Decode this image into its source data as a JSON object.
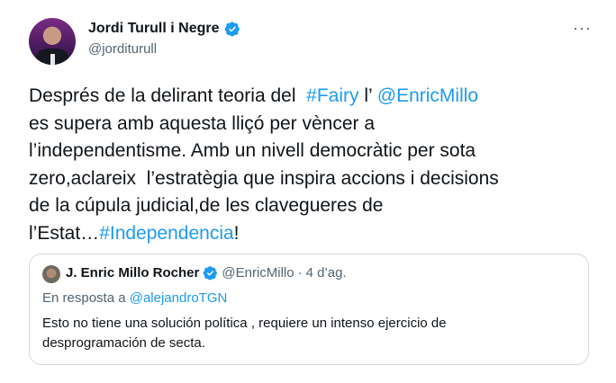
{
  "tweet": {
    "author_name": "Jordi Turull i Negre",
    "author_handle": "@jorditurull",
    "more_label": "···",
    "body": {
      "l1a": "Després de la delirant teoria del  ",
      "l1_hashtag": "#Fairy",
      "l1b": " l’ ",
      "l1_mention": "@EnricMillo",
      "l2": "es supera amb aquesta lliçó per vèncer a",
      "l3": "l’independentisme. Amb un nivell democràtic per sota",
      "l4": "zero,aclareix  l’estratègia que inspira accions i decisions",
      "l5": "de la cúpula judicial,de les clavegueres de",
      "l6a": "l’Estat…",
      "l6_hashtag": "#Independencia",
      "l6b": "!"
    }
  },
  "quote": {
    "author_name": "J. Enric Millo Rocher",
    "author_handle": "@EnricMillo",
    "separator": "·",
    "date": "4 d’ag.",
    "reply_prefix": "En resposta a ",
    "reply_to": "@alejandroTGN",
    "text_l1": "Esto no tiene una solución política , requiere un intenso ejercicio de",
    "text_l2": "desprogramación de secta."
  },
  "colors": {
    "link": "#1d9bf0",
    "verified_badge": "#1d9bf0",
    "secondary_text": "#536471",
    "border": "#cfd9de"
  }
}
